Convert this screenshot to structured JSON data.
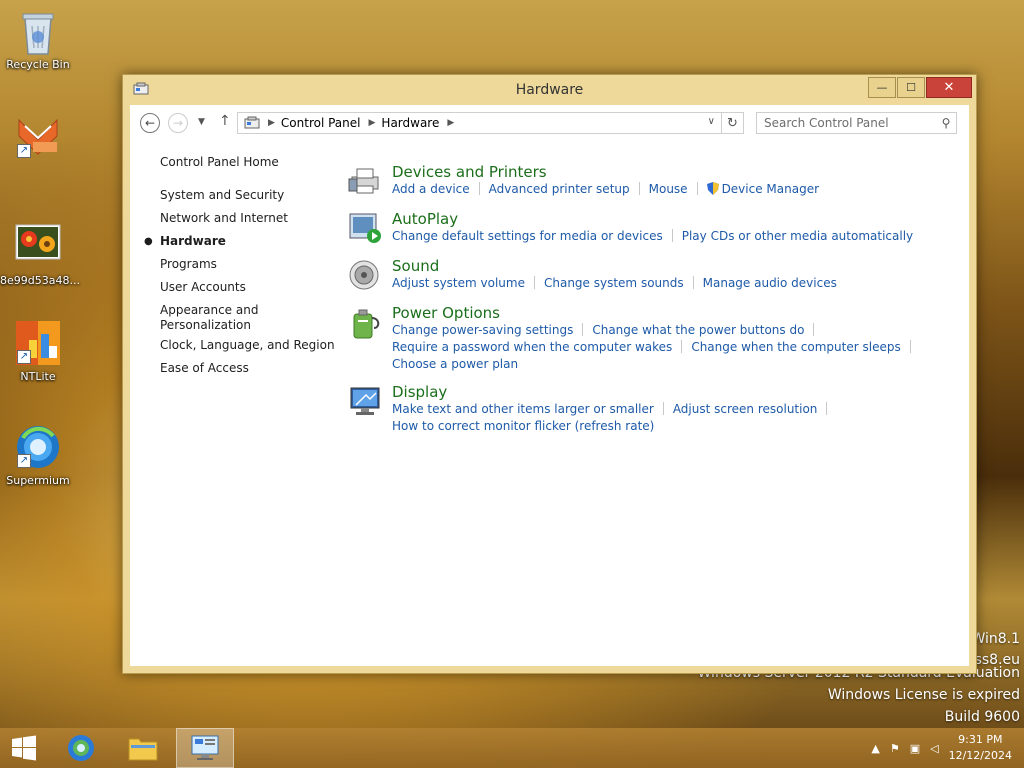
{
  "desktop": {
    "icons": [
      {
        "label": "Recycle Bin",
        "icon": "recycle-bin-icon"
      },
      {
        "label": "",
        "icon": "app-shortcut-icon"
      },
      {
        "label": "8e99d53a48...",
        "icon": "image-file-icon"
      },
      {
        "label": "NTLite",
        "icon": "ntlite-icon"
      },
      {
        "label": "Supermium",
        "icon": "supermium-browser-icon"
      }
    ],
    "watermark": {
      "line1": "Win8.1",
      "line2": "ass8.eu",
      "line3": "Windows Server 2012 R2 Standard Evaluation",
      "line4": "Windows License is expired",
      "line5": "Build 9600"
    }
  },
  "window": {
    "title": "Hardware",
    "controls": {
      "minimize": "—",
      "maximize": "☐",
      "close": "✕"
    },
    "address": {
      "segments": [
        "Control Panel",
        "Hardware"
      ],
      "search_placeholder": "Search Control Panel"
    },
    "leftnav": {
      "home": "Control Panel Home",
      "items": [
        {
          "label": "System and Security",
          "active": false
        },
        {
          "label": "Network and Internet",
          "active": false
        },
        {
          "label": "Hardware",
          "active": true
        },
        {
          "label": "Programs",
          "active": false
        },
        {
          "label": "User Accounts",
          "active": false
        },
        {
          "label": "Appearance and Personalization",
          "active": false
        },
        {
          "label": "Clock, Language, and Region",
          "active": false
        },
        {
          "label": "Ease of Access",
          "active": false
        }
      ],
      "appearance_line1": "Appearance and",
      "appearance_line2": "Personalization"
    },
    "categories": [
      {
        "title": "Devices and Printers",
        "icon": "printer-icon",
        "links": [
          "Add a device",
          "Advanced printer setup",
          "Mouse",
          "Device Manager"
        ]
      },
      {
        "title": "AutoPlay",
        "icon": "autoplay-icon",
        "links": [
          "Change default settings for media or devices",
          "Play CDs or other media automatically"
        ]
      },
      {
        "title": "Sound",
        "icon": "speaker-icon",
        "links": [
          "Adjust system volume",
          "Change system sounds",
          "Manage audio devices"
        ]
      },
      {
        "title": "Power Options",
        "icon": "power-options-icon",
        "links": [
          "Change power-saving settings",
          "Change what the power buttons do",
          "Require a password when the computer wakes",
          "Change when the computer sleeps",
          "Choose a power plan"
        ]
      },
      {
        "title": "Display",
        "icon": "monitor-icon",
        "links": [
          "Make text and other items larger or smaller",
          "Adjust screen resolution",
          "How to correct monitor flicker (refresh rate)"
        ]
      }
    ]
  },
  "taskbar": {
    "buttons": [
      "start-button",
      "ie-browser",
      "file-explorer",
      "control-panel"
    ],
    "clock": {
      "time": "9:31 PM",
      "date": "12/12/2024"
    }
  }
}
